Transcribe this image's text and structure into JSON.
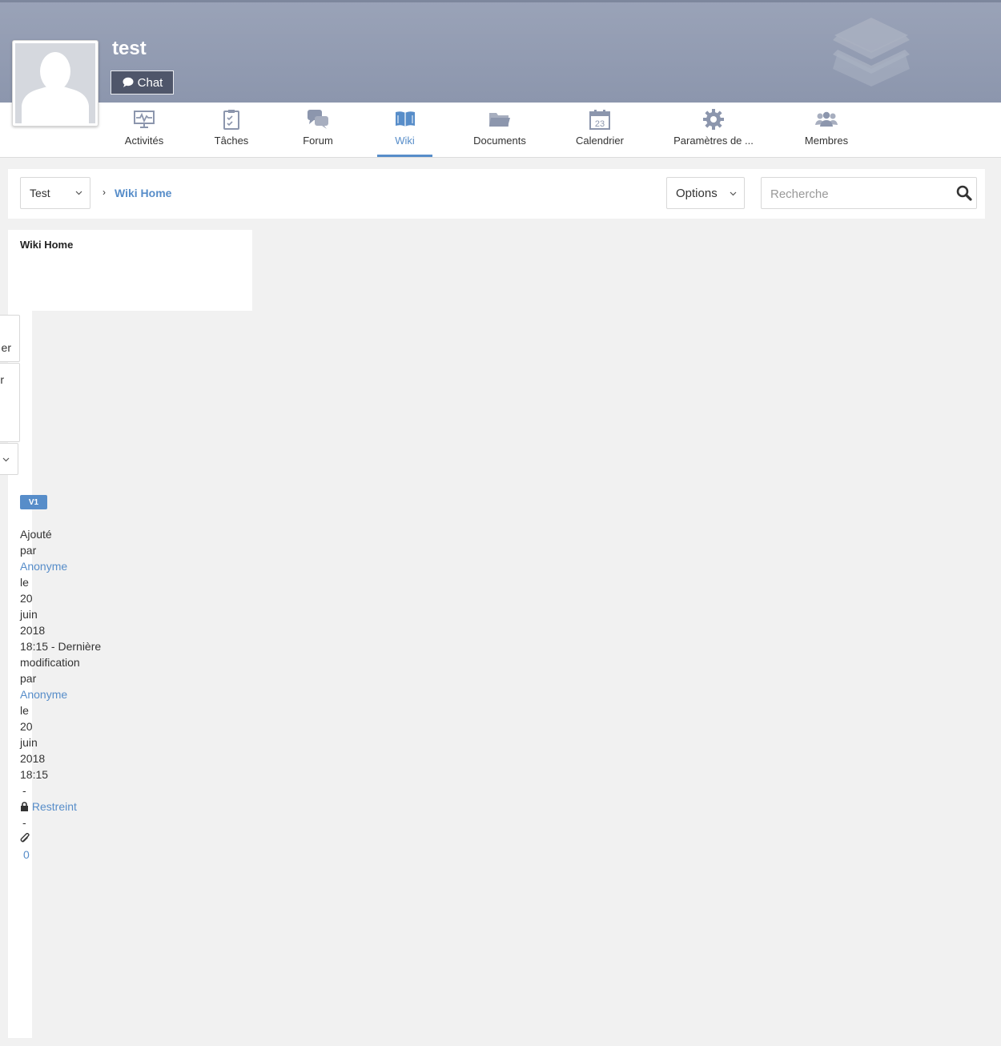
{
  "space": {
    "title": "test",
    "chat_label": "Chat"
  },
  "nav": {
    "items": [
      {
        "label": "Activités",
        "icon": "activity-icon"
      },
      {
        "label": "Tâches",
        "icon": "tasks-icon"
      },
      {
        "label": "Forum",
        "icon": "forum-icon"
      },
      {
        "label": "Wiki",
        "icon": "wiki-book-icon",
        "active": true
      },
      {
        "label": "Documents",
        "icon": "folder-icon"
      },
      {
        "label": "Calendrier",
        "icon": "calendar-icon",
        "day": "23"
      },
      {
        "label": "Paramètres de ...",
        "icon": "gear-icon"
      },
      {
        "label": "Membres",
        "icon": "members-icon"
      }
    ]
  },
  "toolbar": {
    "wiki_select": "Test",
    "breadcrumb_sep": "›",
    "breadcrumb_current": "Wiki Home",
    "options_label": "Options",
    "search_placeholder": "Recherche"
  },
  "tree": {
    "title": "Wiki Home"
  },
  "clipped": {
    "btn1": "er",
    "btn2": "r"
  },
  "page_info": {
    "version": "V1",
    "added_word": "Ajouté",
    "by_1": "par",
    "author_1": "Anonyme",
    "on_1": "le",
    "day_1": "20",
    "month_1": "juin",
    "year_1": "2018",
    "time_1": "18:15 - Dernière",
    "modification": "modification",
    "by_2": "par",
    "author_2": "Anonyme",
    "on_2": "le",
    "day_2": "20",
    "month_2": "juin",
    "year_2": "2018",
    "time_2": "18:15",
    "dash_1": "-",
    "restricted": "Restreint",
    "dash_2": "-",
    "attachments_count": "0"
  },
  "colors": {
    "accent": "#578dc9",
    "banner": "#9aa3b8",
    "chat_button": "#4f566a",
    "background": "#f1f1f1"
  }
}
